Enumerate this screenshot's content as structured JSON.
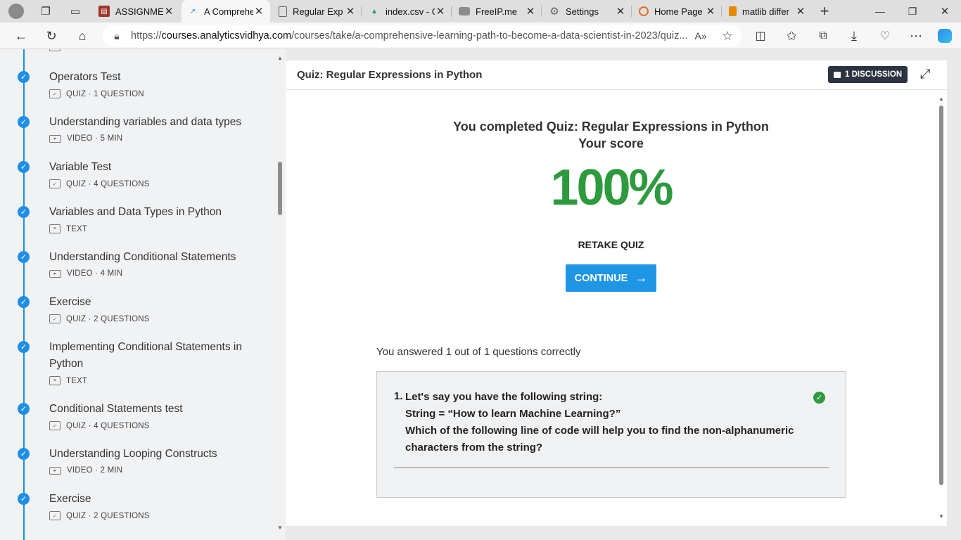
{
  "browser": {
    "tabs": [
      {
        "title": "ASSIGNMENT",
        "icon": "pdf-icon",
        "active": false
      },
      {
        "title": "A Comprehensive",
        "icon": "analytics-icon",
        "active": true
      },
      {
        "title": "Regular Exp",
        "icon": "page-icon",
        "active": false
      },
      {
        "title": "index.csv - G",
        "icon": "drive-icon",
        "active": false
      },
      {
        "title": "FreeIP.me",
        "icon": "ip-icon",
        "active": false
      },
      {
        "title": "Settings",
        "icon": "gear-icon",
        "active": false
      },
      {
        "title": "Home Page",
        "icon": "home-icon",
        "active": false
      },
      {
        "title": "matlib differ",
        "icon": "bookmark-icon",
        "active": false
      }
    ],
    "url_prefix": "https://",
    "url_domain": "courses.analyticsvidhya.com",
    "url_path": "/courses/take/a-comprehensive-learning-path-to-become-a-data-scientist-in-2023/quiz..."
  },
  "sidebar": {
    "items": [
      {
        "title": "",
        "type": "TEXT"
      },
      {
        "title": "Operators Test",
        "type": "QUIZ · 1 QUESTION",
        "kind": "quiz"
      },
      {
        "title": "Understanding variables and data types",
        "type": "VIDEO · 5 MIN",
        "kind": "video"
      },
      {
        "title": "Variable Test",
        "type": "QUIZ · 4 QUESTIONS",
        "kind": "quiz"
      },
      {
        "title": "Variables and Data Types in Python",
        "type": "TEXT",
        "kind": "text"
      },
      {
        "title": "Understanding Conditional Statements",
        "type": "VIDEO · 4 MIN",
        "kind": "video"
      },
      {
        "title": "Exercise",
        "type": "QUIZ · 2 QUESTIONS",
        "kind": "quiz"
      },
      {
        "title": "Implementing Conditional Statements in Python",
        "type": "TEXT",
        "kind": "text"
      },
      {
        "title": "Conditional Statements test",
        "type": "QUIZ · 4 QUESTIONS",
        "kind": "quiz"
      },
      {
        "title": "Understanding Looping Constructs",
        "type": "VIDEO · 2 MIN",
        "kind": "video"
      },
      {
        "title": "Exercise",
        "type": "QUIZ · 2 QUESTIONS",
        "kind": "quiz"
      }
    ]
  },
  "main": {
    "header_title": "Quiz: Regular Expressions in Python",
    "discussion_label": "1 DISCUSSION",
    "completed_text": "You completed Quiz: Regular Expressions in Python",
    "score_label": "Your score",
    "score_value": "100%",
    "retake_label": "RETAKE QUIZ",
    "continue_label": "CONTINUE",
    "answered_text": "You answered 1 out of 1 questions correctly",
    "question": {
      "number": "1.",
      "lines": [
        "Let's say you have the following  string:",
        "String = “How to learn Machine Learning?”",
        "Which of the following line of code will help you to find the non-alphanumeric",
        "characters from the string?"
      ],
      "correct": true
    }
  },
  "colors": {
    "accent": "#1f95e6",
    "success": "#2e9a3e",
    "dark_badge": "#2b3440"
  }
}
